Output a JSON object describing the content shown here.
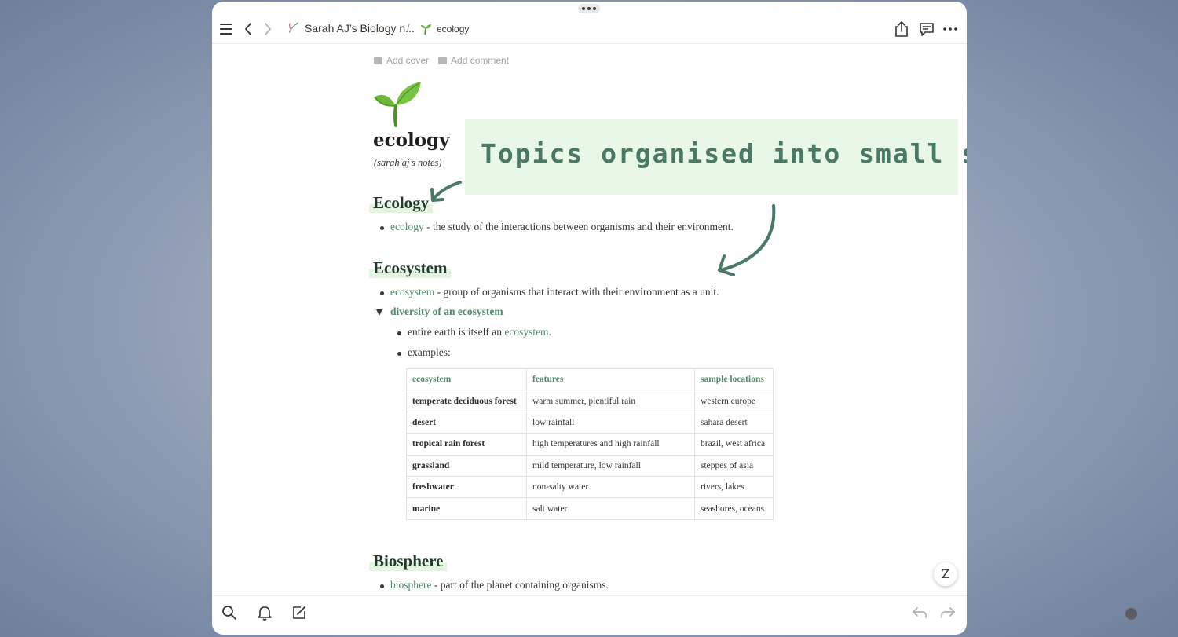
{
  "topbar": {
    "breadcrumb_parent": "Sarah AJ’s Biology n...",
    "separator": "/",
    "breadcrumb_current": "ecology"
  },
  "meta": {
    "add_cover": "Add cover",
    "add_comment": "Add comment"
  },
  "page": {
    "title": "ecology",
    "subtitle": "(sarah aj’s notes)"
  },
  "callout": {
    "text": "Topics organised into small sections"
  },
  "sections": {
    "ecology": {
      "heading": "Ecology",
      "bullet_link": "ecology",
      "bullet_text": " - the study of the interactions between organisms and their environment."
    },
    "ecosystem": {
      "heading": "Ecosystem",
      "bullet_link": "ecosystem",
      "bullet_text": " - group of organisms that interact with their environment as a unit.",
      "toggle": "diversity of an ecosystem",
      "sub1_text": "entire earth is itself an ",
      "sub1_link": "ecosystem",
      "sub1_end": ".",
      "sub2": "examples:"
    },
    "biosphere": {
      "heading": "Biosphere",
      "bullet_link": "biosphere",
      "bullet_text": " - part of the planet containing organisms."
    }
  },
  "table": {
    "headers": [
      "ecosystem",
      "features",
      "sample locations"
    ],
    "rows": [
      [
        "temperate deciduous forest",
        "warm summer, plentiful rain",
        "western europe"
      ],
      [
        "desert",
        "low rainfall",
        "sahara desert"
      ],
      [
        "tropical rain forest",
        "high temperatures and high rainfall",
        "brazil, west africa"
      ],
      [
        "grassland",
        "mild temperature, low rainfall",
        "steppes of asia"
      ],
      [
        "freshwater",
        "non-salty water",
        "rivers, lakes"
      ],
      [
        "marine",
        "salt water",
        "seashores, oceans"
      ]
    ]
  },
  "colors": {
    "accent": "#4f8a66",
    "callout_bg": "#e8f7e6",
    "callout_text": "#4a7a66",
    "heading_highlight": "#e5f4e0"
  },
  "icons": [
    "menu-icon",
    "back-icon",
    "forward-icon",
    "sprout-icon",
    "share-icon",
    "comments-icon",
    "more-icon",
    "search-icon",
    "bell-icon",
    "compose-icon",
    "undo-icon",
    "redo-icon",
    "handwriting-icon"
  ]
}
